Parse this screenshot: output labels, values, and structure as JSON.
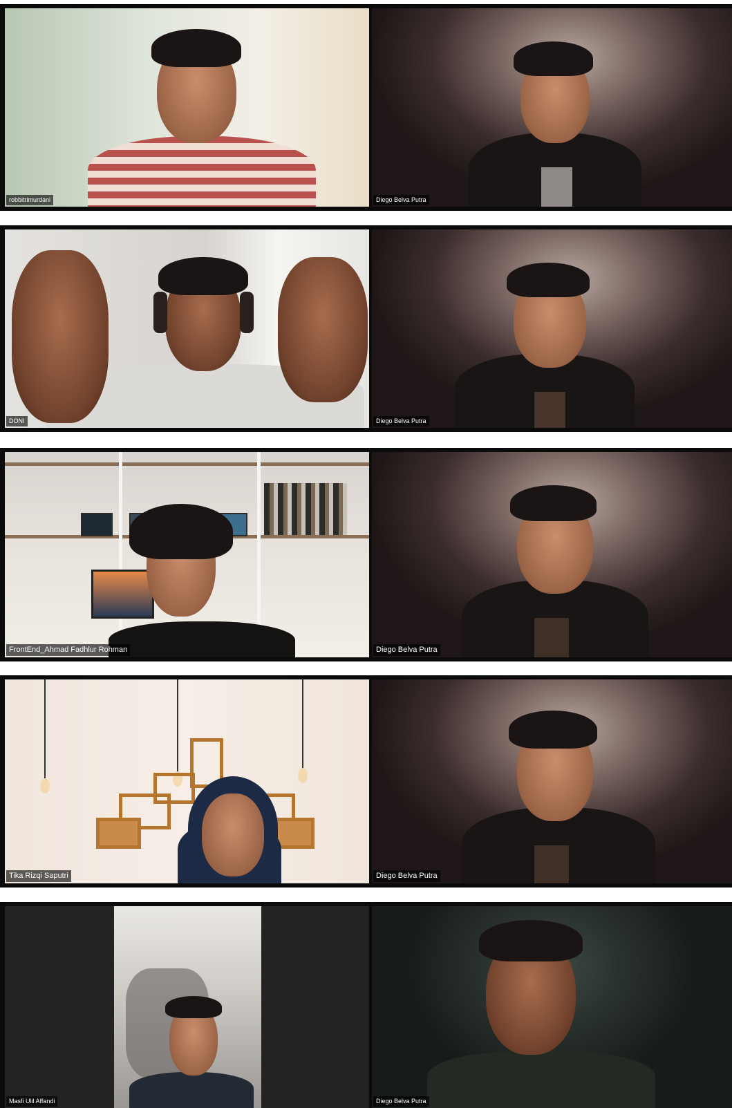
{
  "meeting": {
    "rows": [
      {
        "left_name": "robbitrimurdani",
        "right_name": "Diego Belva Putra"
      },
      {
        "left_name": "DONI",
        "right_name": "Diego Belva Putra"
      },
      {
        "left_name": "FrontEnd_Ahmad Fadhlur Rohman",
        "right_name": "Diego Belva Putra"
      },
      {
        "left_name": "Tika Rizqi Saputri",
        "right_name": "Diego Belva Putra"
      },
      {
        "left_name": "Masfi Ulil Affandi",
        "right_name": "Diego Belva Putra"
      }
    ]
  }
}
